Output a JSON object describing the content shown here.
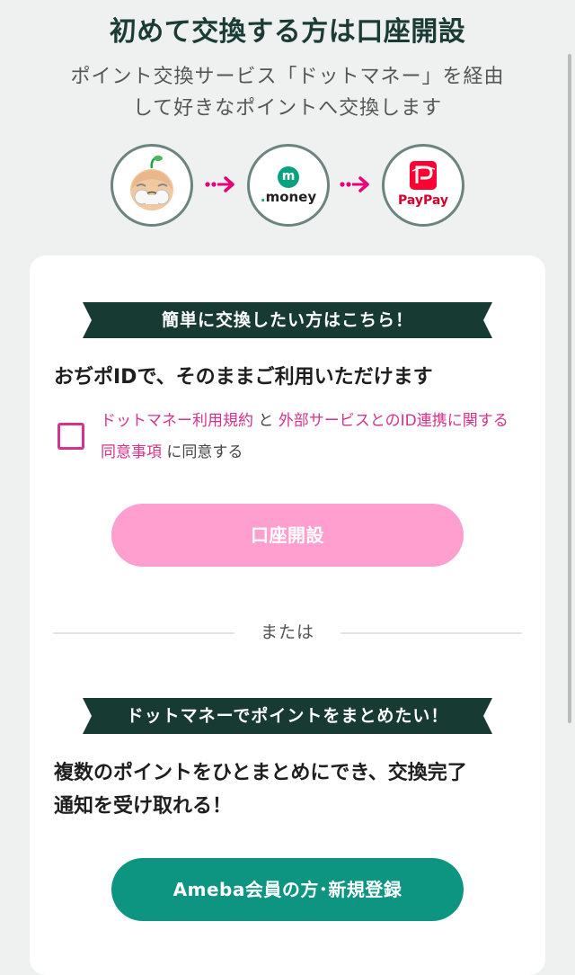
{
  "header": {
    "title": "初めて交換する方は口座開設",
    "subtitle_line1": "ポイント交換サービス「ドットマネー」を経由",
    "subtitle_line2": "して好きなポイントへ交換します"
  },
  "flow": {
    "steps": [
      {
        "icon": "odigo-character-icon"
      },
      {
        "icon": "dotmoney-logo-icon",
        "label": "money"
      },
      {
        "icon": "paypay-logo-icon",
        "label": "PayPay"
      }
    ],
    "colors": {
      "arrow": "#e6007e",
      "border": "#6c847e"
    }
  },
  "section_easy": {
    "ribbon": "簡単に交換したい方はこちら！",
    "lead": "おぢポIDで、そのままご利用いただけます",
    "consent": {
      "link1": "ドットマネー利用規約",
      "and": " と ",
      "link2": "外部サービスとのID連携に関する同意事項",
      "suffix": " に同意する"
    },
    "button": "口座開設"
  },
  "divider": {
    "label": "または"
  },
  "section_collect": {
    "ribbon": "ドットマネーでポイントをまとめたい！",
    "lead_line1": "複数のポイントをひとまとめにでき、交換完了",
    "lead_line2": "通知を受け取れる！",
    "button": "Ameba会員の方･新規登録"
  },
  "colors": {
    "ribbon": "#173a33",
    "accent_pink": "#d6338c",
    "button_disabled": "#ff9fcf",
    "button_primary": "#0e9582",
    "background": "#eef1f0"
  }
}
